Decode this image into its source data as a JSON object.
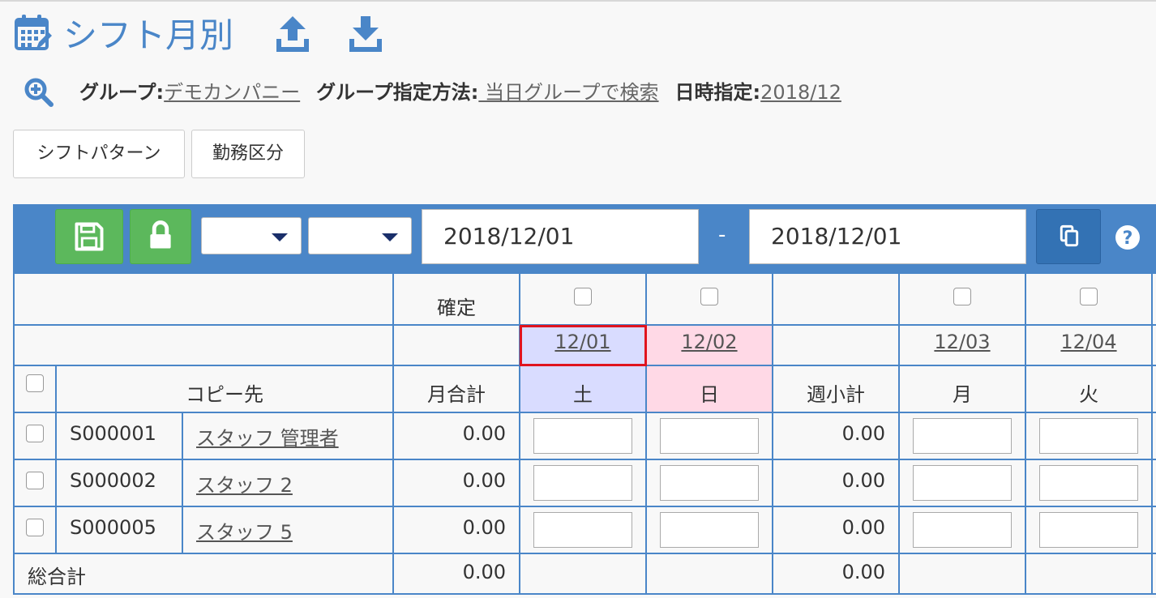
{
  "header": {
    "title": "シフト月別",
    "icons": {
      "calendar": "calendar-edit-icon",
      "upload": "upload-icon",
      "download": "download-icon"
    }
  },
  "filters": {
    "group_label": "グループ:",
    "group_value": "デモカンパニー",
    "method_label": "グループ指定方法:",
    "method_value": " 当日グループで検索",
    "date_label": "日時指定:",
    "date_value": "2018/12"
  },
  "tabs": {
    "shift_pattern": "シフトパターン",
    "kinmu_kubun": "勤務区分"
  },
  "toolbar": {
    "select1_value": "",
    "select2_value": "",
    "date_from": "2018/12/01",
    "date_separator": "-",
    "date_to": "2018/12/01",
    "colors": {
      "bar": "#4a86c8",
      "green": "#5cb85c",
      "copy": "#3372b4"
    }
  },
  "table": {
    "confirm_label": "確定",
    "copy_dest_label": "コピー先",
    "month_total_label": "月合計",
    "week_subtotal_label": "週小計",
    "grand_total_label": "総合計",
    "dates": [
      "12/01",
      "12/02",
      "12/03",
      "12/04"
    ],
    "weekdays": [
      "土",
      "日",
      "月",
      "火"
    ],
    "rows": [
      {
        "code": "S000001",
        "name": "スタッフ 管理者",
        "month_total": "0.00",
        "week_subtotal": "0.00"
      },
      {
        "code": "S000002",
        "name": "スタッフ 2",
        "month_total": "0.00",
        "week_subtotal": "0.00"
      },
      {
        "code": "S000005",
        "name": "スタッフ 5",
        "month_total": "0.00",
        "week_subtotal": "0.00"
      }
    ],
    "grand_month_total": "0.00",
    "grand_week_subtotal": "0.00",
    "colors": {
      "saturday": "#d9dcff",
      "sunday": "#ffd9e6",
      "selected_outline": "#e0141e"
    }
  }
}
